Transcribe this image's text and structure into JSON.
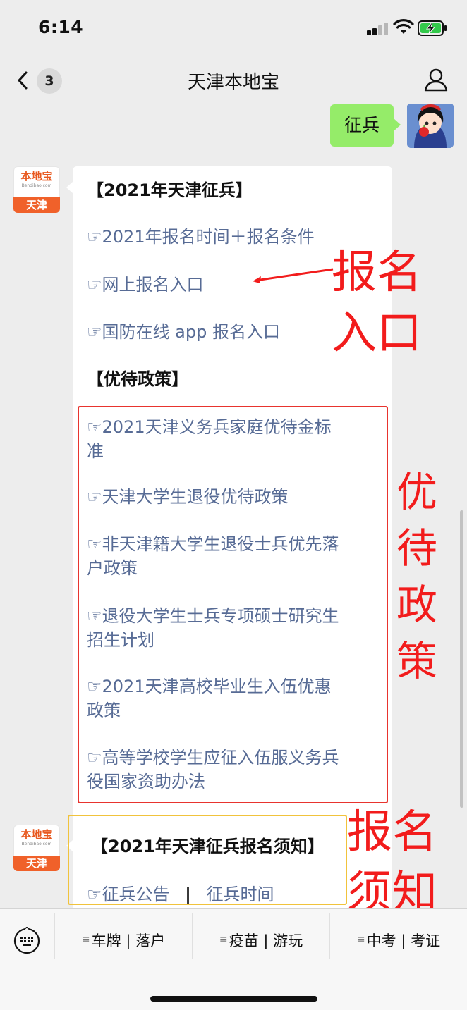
{
  "status_bar": {
    "time": "6:14"
  },
  "nav": {
    "back_count": "3",
    "title": "天津本地宝"
  },
  "bot": {
    "logo_text": "本地宝",
    "logo_url": "Bendibao.com",
    "logo_city": "天津"
  },
  "chat": {
    "user_message": "征兵",
    "msg1": {
      "heading1": "【2021年天津征兵】",
      "link1": "☞2021年报名时间＋报名条件",
      "link2": "☞网上报名入口",
      "link3": "☞国防在线 app 报名入口",
      "heading2": "【优待政策】",
      "policy1a": "☞2021天津义务兵家庭优待金标",
      "policy1b": "准",
      "policy2": "☞天津大学生退役优待政策",
      "policy3a": "☞非天津籍大学生退役士兵优先落",
      "policy3b": "户政策",
      "policy4a": "☞退役大学生士兵专项硕士研究生",
      "policy4b": "招生计划",
      "policy5a": "☞2021天津高校毕业生入伍优惠",
      "policy5b": "政策",
      "policy6a": "☞高等学校学生应征入伍服义务兵",
      "policy6b": "役国家资助办法"
    },
    "msg2": {
      "heading": "【2021年天津征兵报名须知】",
      "link_a": "☞征兵公告",
      "separator": "|",
      "link_b": "征兵时间"
    }
  },
  "annotations": {
    "a1_line1": "报名",
    "a1_line2": "入口",
    "a2_c1": "优",
    "a2_c2": "待",
    "a2_c3": "政",
    "a2_c4": "策",
    "a3_line1": "报名",
    "a3_line2": "须知",
    "color": "#f21c1c"
  },
  "bottom_menu": {
    "item1": "车牌 | 落户",
    "item2": "疫苗 | 游玩",
    "item3": "中考 | 考证"
  },
  "colors": {
    "user_bubble": "#95ec69",
    "link": "#576b95",
    "policy_box": "#e8342e",
    "notice_box": "#f1c33c"
  }
}
